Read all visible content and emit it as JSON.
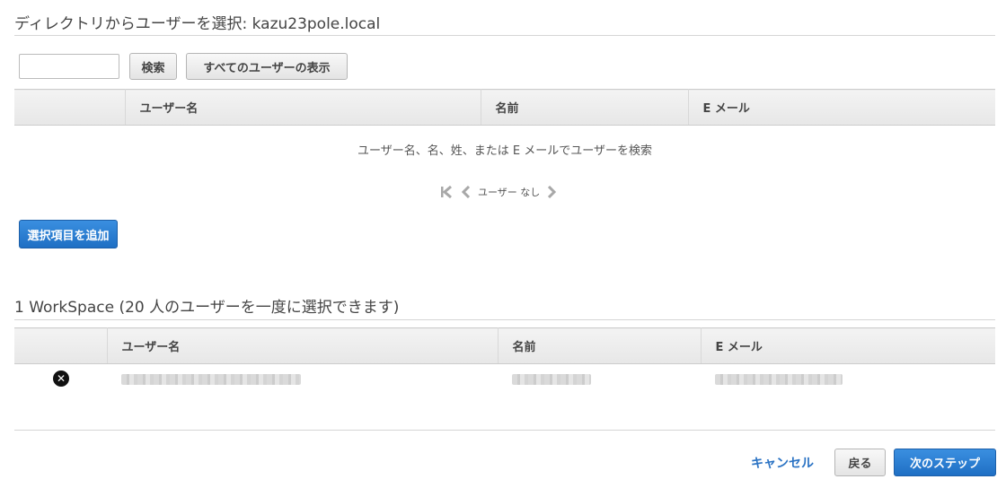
{
  "directory_section": {
    "title": "ディレクトリからユーザーを選択: kazu23pole.local",
    "search": {
      "value": "",
      "placeholder": ""
    },
    "search_button": "検索",
    "show_all_button": "すべてのユーザーの表示",
    "columns": [
      "",
      "ユーザー名",
      "名前",
      "E メール"
    ],
    "empty_message": "ユーザー名、名、姓、または E メールでユーザーを検索",
    "pagination": {
      "text": "ユーザー なし",
      "icons": [
        "first-page-icon",
        "prev-page-icon",
        "next-page-icon"
      ]
    },
    "add_button": "選択項目を追加"
  },
  "selected_section": {
    "title": "1 WorkSpace (20 人のユーザーを一度に選択できます)",
    "columns": [
      "",
      "ユーザー名",
      "名前",
      "E メール"
    ],
    "rows": [
      {
        "remove_icon": "close-circle-icon",
        "username": "",
        "name": "",
        "email": ""
      }
    ]
  },
  "footer": {
    "cancel_link": "キャンセル",
    "back_button": "戻る",
    "next_button": "次のステップ"
  },
  "colors": {
    "primary": "#2b73c4",
    "primary_dark": "#1f6fc4",
    "link": "#2b73c4"
  }
}
